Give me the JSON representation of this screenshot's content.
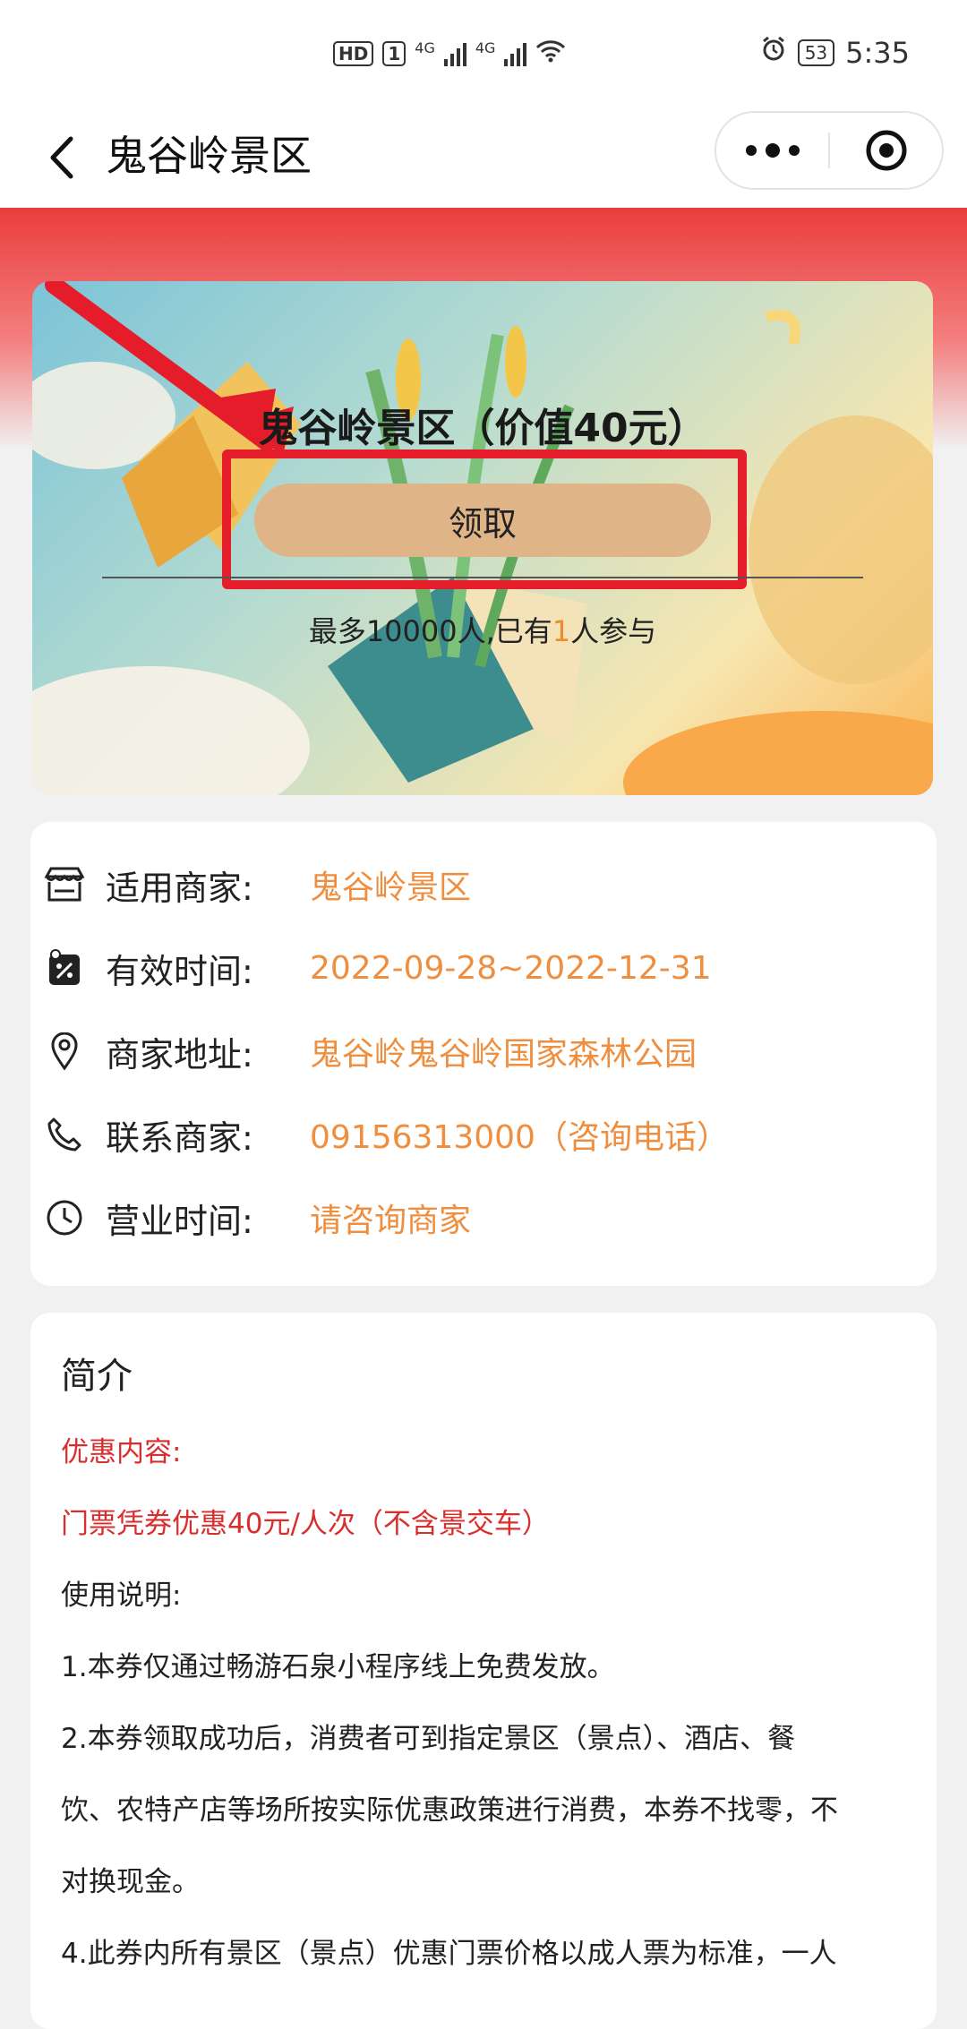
{
  "status_bar": {
    "hd_label": "HD",
    "sim_label": "1",
    "net1": "4G",
    "net2": "4G",
    "battery": "53",
    "time": "5:35"
  },
  "nav": {
    "title": "鬼谷岭景区"
  },
  "coupon": {
    "title": "鬼谷岭景区（价值40元）",
    "claim_label": "领取",
    "participants_prefix": "最多10000人,已有",
    "participants_count": "1",
    "participants_suffix": "人参与"
  },
  "info": {
    "rows": [
      {
        "icon": "store-icon",
        "label": "适用商家:",
        "value": "鬼谷岭景区"
      },
      {
        "icon": "calendar-icon",
        "label": "有效时间:",
        "value": "2022-09-28~2022-12-31"
      },
      {
        "icon": "location-pin-icon",
        "label": "商家地址:",
        "value": "鬼谷岭鬼谷岭国家森林公园"
      },
      {
        "icon": "phone-icon",
        "label": "联系商家:",
        "value": "09156313000（咨询电话）"
      },
      {
        "icon": "clock-icon",
        "label": "营业时间:",
        "value": "请咨询商家"
      }
    ]
  },
  "intro": {
    "title": "简介",
    "lines": [
      "优惠内容:",
      "门票凭券优惠40元/人次（不含景交车）",
      "使用说明:",
      "1.本券仅通过畅游石泉小程序线上免费发放。",
      "2.本券领取成功后，消费者可到指定景区（景点）、酒店、餐",
      "饮、农特产店等场所按实际优惠政策进行消费，本券不找零，不",
      "对换现金。",
      "4.此券内所有景区（景点）优惠门票价格以成人票为标准，一人"
    ]
  },
  "colors": {
    "accent_orange": "#ee8e3e",
    "highlight_red": "#e51d2a",
    "claim_button": "#dfb487",
    "intro_red": "#d92e2e"
  }
}
